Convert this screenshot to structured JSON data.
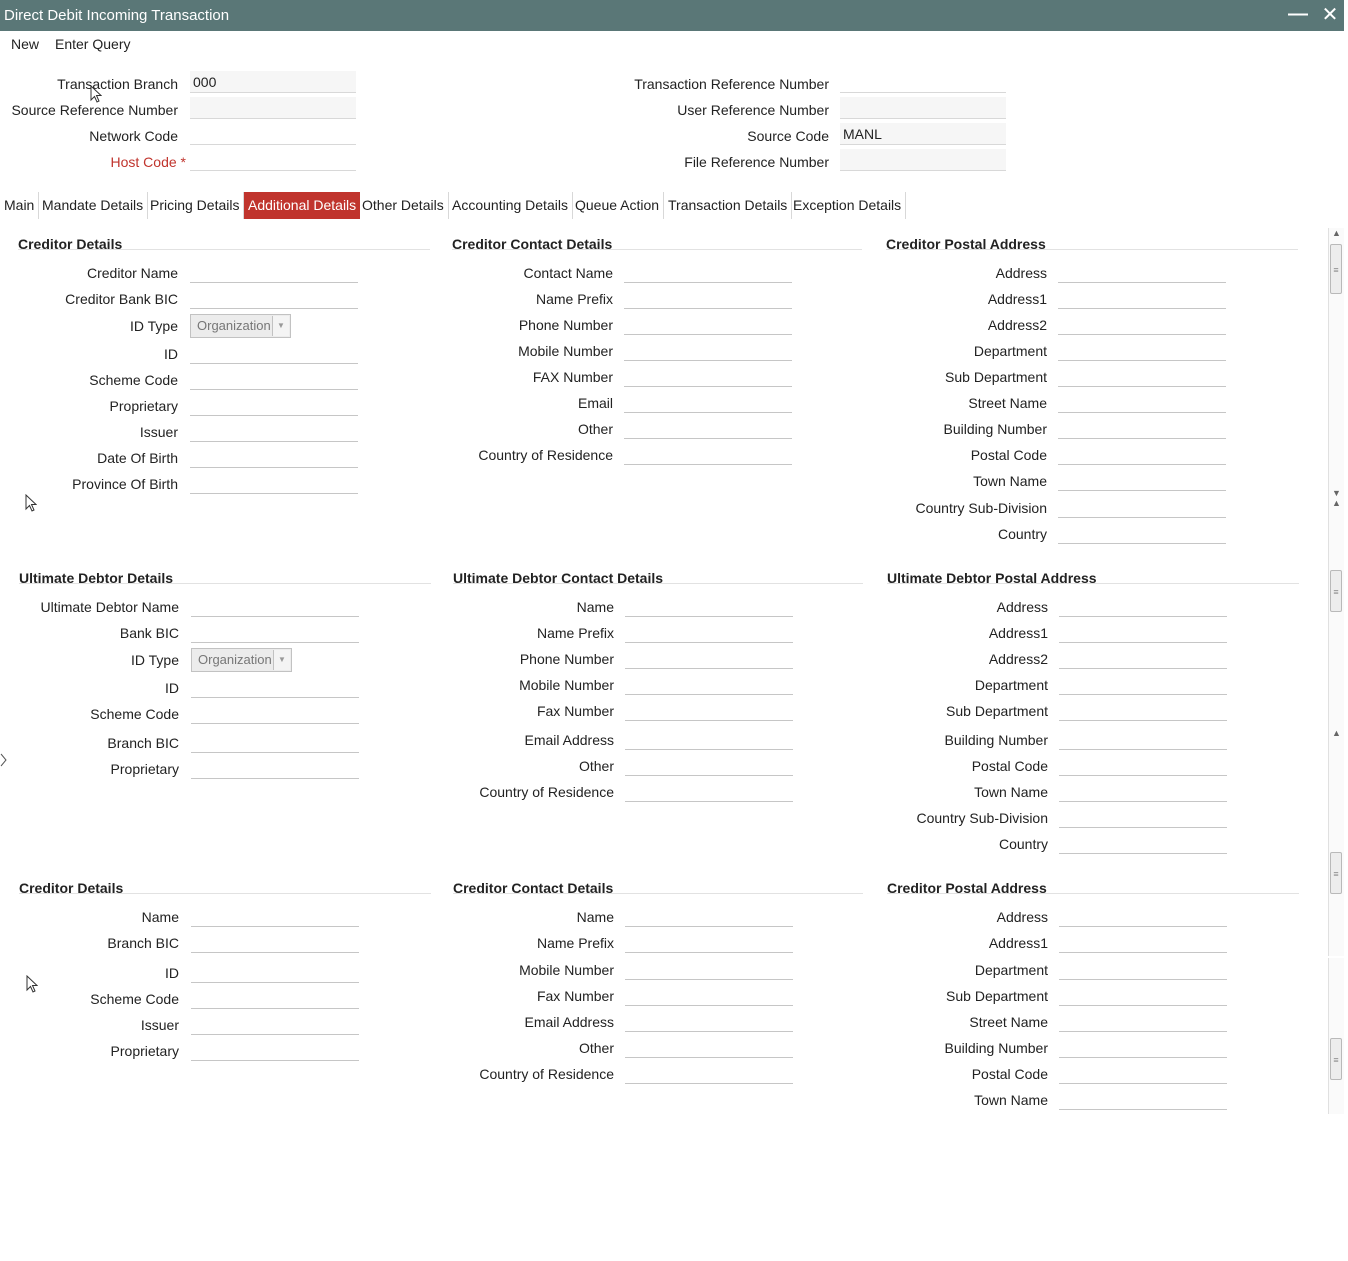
{
  "window": {
    "title": "Direct Debit Incoming Transaction",
    "minimize_glyph": "—",
    "close_glyph": "✕"
  },
  "menu": {
    "new": "New",
    "enter_query": "Enter Query"
  },
  "header": {
    "transaction_branch": {
      "label": "Transaction Branch",
      "value": "000"
    },
    "source_reference_number": {
      "label": "Source Reference Number",
      "value": ""
    },
    "network_code": {
      "label": "Network Code",
      "value": ""
    },
    "host_code": {
      "label": "Host Code",
      "required_mark": "*",
      "value": ""
    },
    "transaction_reference_number": {
      "label": "Transaction Reference Number",
      "value": ""
    },
    "user_reference_number": {
      "label": "User Reference Number",
      "value": ""
    },
    "source_code": {
      "label": "Source Code",
      "value": "MANL"
    },
    "file_reference_number": {
      "label": "File Reference Number",
      "value": ""
    }
  },
  "tabs": [
    "Main",
    "Mandate Details",
    "Pricing Details",
    "Additional Details",
    "Other Details",
    "Accounting Details",
    "Queue Action",
    "Transaction Details",
    "Exception Details"
  ],
  "active_tab": "Additional Details",
  "accent_color": "#c0342d",
  "titlebar_color": "#5a7777",
  "sections": [
    {
      "title": "Creditor Details",
      "fields": [
        {
          "label": "Creditor Name",
          "type": "text",
          "value": ""
        },
        {
          "label": "Creditor Bank BIC",
          "type": "text",
          "value": ""
        },
        {
          "label": "ID Type",
          "type": "select",
          "value": "Organization"
        },
        {
          "label": "ID",
          "type": "text",
          "value": ""
        },
        {
          "label": "Scheme Code",
          "type": "text",
          "value": ""
        },
        {
          "label": "Proprietary",
          "type": "text",
          "value": ""
        },
        {
          "label": "Issuer",
          "type": "text",
          "value": ""
        },
        {
          "label": "Date Of Birth",
          "type": "text",
          "value": ""
        },
        {
          "label": "Province Of Birth",
          "type": "text",
          "value": ""
        }
      ]
    },
    {
      "title": "Creditor Contact Details",
      "fields": [
        {
          "label": "Contact Name",
          "type": "text",
          "value": ""
        },
        {
          "label": "Name Prefix",
          "type": "text",
          "value": ""
        },
        {
          "label": "Phone Number",
          "type": "text",
          "value": ""
        },
        {
          "label": "Mobile Number",
          "type": "text",
          "value": ""
        },
        {
          "label": "FAX Number",
          "type": "text",
          "value": ""
        },
        {
          "label": "Email",
          "type": "text",
          "value": ""
        },
        {
          "label": "Other",
          "type": "text",
          "value": ""
        },
        {
          "label": "Country of Residence",
          "type": "text",
          "value": ""
        }
      ]
    },
    {
      "title": "Creditor Postal Address",
      "fields": [
        {
          "label": "Address",
          "type": "text",
          "value": ""
        },
        {
          "label": "Address1",
          "type": "text",
          "value": ""
        },
        {
          "label": "Address2",
          "type": "text",
          "value": ""
        },
        {
          "label": "Department",
          "type": "text",
          "value": ""
        },
        {
          "label": "Sub Department",
          "type": "text",
          "value": ""
        },
        {
          "label": "Street Name",
          "type": "text",
          "value": ""
        },
        {
          "label": "Building Number",
          "type": "text",
          "value": ""
        },
        {
          "label": "Postal Code",
          "type": "text",
          "value": ""
        },
        {
          "label": "Town Name",
          "type": "text",
          "value": ""
        },
        {
          "label": "Country Sub-Division",
          "type": "text",
          "value": ""
        },
        {
          "label": "Country",
          "type": "text",
          "value": ""
        }
      ]
    },
    {
      "title": "Ultimate Debtor Details",
      "fields": [
        {
          "label": "Ultimate Debtor Name",
          "type": "text",
          "value": ""
        },
        {
          "label": "Bank BIC",
          "type": "text",
          "value": ""
        },
        {
          "label": "ID Type",
          "type": "select",
          "value": "Organization"
        },
        {
          "label": "ID",
          "type": "text",
          "value": ""
        },
        {
          "label": "Scheme Code",
          "type": "text",
          "value": ""
        },
        {
          "label": "Branch BIC",
          "type": "text",
          "value": ""
        },
        {
          "label": "Proprietary",
          "type": "text",
          "value": ""
        }
      ]
    },
    {
      "title": "Ultimate Debtor Contact Details",
      "fields": [
        {
          "label": "Name",
          "type": "text",
          "value": ""
        },
        {
          "label": "Name Prefix",
          "type": "text",
          "value": ""
        },
        {
          "label": "Phone Number",
          "type": "text",
          "value": ""
        },
        {
          "label": "Mobile Number",
          "type": "text",
          "value": ""
        },
        {
          "label": "Fax Number",
          "type": "text",
          "value": ""
        },
        {
          "label": "Email Address",
          "type": "text",
          "value": ""
        },
        {
          "label": "Other",
          "type": "text",
          "value": ""
        },
        {
          "label": "Country of Residence",
          "type": "text",
          "value": ""
        }
      ]
    },
    {
      "title": "Ultimate Debtor Postal Address",
      "fields": [
        {
          "label": "Address",
          "type": "text",
          "value": ""
        },
        {
          "label": "Address1",
          "type": "text",
          "value": ""
        },
        {
          "label": "Address2",
          "type": "text",
          "value": ""
        },
        {
          "label": "Department",
          "type": "text",
          "value": ""
        },
        {
          "label": "Sub Department",
          "type": "text",
          "value": ""
        },
        {
          "label": "Building Number",
          "type": "text",
          "value": ""
        },
        {
          "label": "Postal Code",
          "type": "text",
          "value": ""
        },
        {
          "label": "Town Name",
          "type": "text",
          "value": ""
        },
        {
          "label": "Country Sub-Division",
          "type": "text",
          "value": ""
        },
        {
          "label": "Country",
          "type": "text",
          "value": ""
        }
      ]
    },
    {
      "title": "Creditor Details",
      "fields": [
        {
          "label": "Name",
          "type": "text",
          "value": ""
        },
        {
          "label": "Branch BIC",
          "type": "text",
          "value": ""
        },
        {
          "label": "ID",
          "type": "text",
          "value": ""
        },
        {
          "label": "Scheme Code",
          "type": "text",
          "value": ""
        },
        {
          "label": "Issuer",
          "type": "text",
          "value": ""
        },
        {
          "label": "Proprietary",
          "type": "text",
          "value": ""
        }
      ]
    },
    {
      "title": "Creditor Contact Details",
      "fields": [
        {
          "label": "Name",
          "type": "text",
          "value": ""
        },
        {
          "label": "Name Prefix",
          "type": "text",
          "value": ""
        },
        {
          "label": "Mobile Number",
          "type": "text",
          "value": ""
        },
        {
          "label": "Fax Number",
          "type": "text",
          "value": ""
        },
        {
          "label": "Email Address",
          "type": "text",
          "value": ""
        },
        {
          "label": "Other",
          "type": "text",
          "value": ""
        },
        {
          "label": "Country of Residence",
          "type": "text",
          "value": ""
        }
      ]
    },
    {
      "title": "Creditor Postal Address",
      "fields": [
        {
          "label": "Address",
          "type": "text",
          "value": ""
        },
        {
          "label": "Address1",
          "type": "text",
          "value": ""
        },
        {
          "label": "Department",
          "type": "text",
          "value": ""
        },
        {
          "label": "Sub Department",
          "type": "text",
          "value": ""
        },
        {
          "label": "Street Name",
          "type": "text",
          "value": ""
        },
        {
          "label": "Building Number",
          "type": "text",
          "value": ""
        },
        {
          "label": "Postal Code",
          "type": "text",
          "value": ""
        },
        {
          "label": "Town Name",
          "type": "text",
          "value": ""
        }
      ]
    }
  ]
}
